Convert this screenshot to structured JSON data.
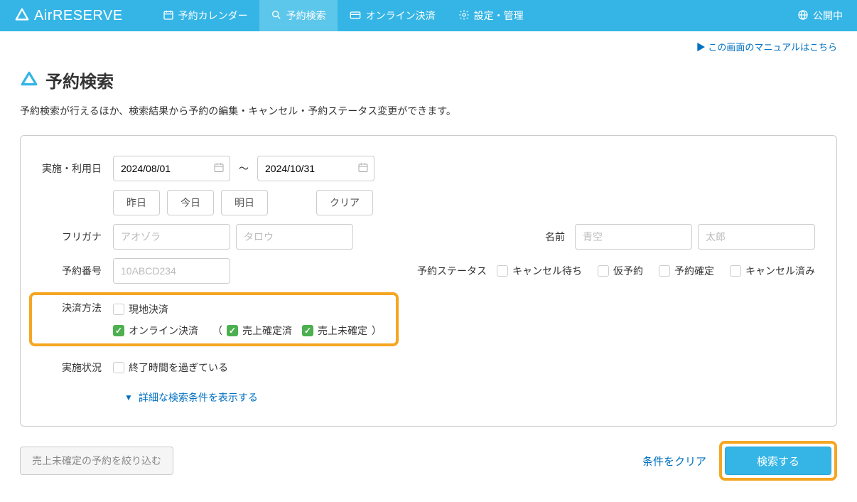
{
  "header": {
    "logo_text": "AirRESERVE",
    "nav": [
      {
        "label": "予約カレンダー"
      },
      {
        "label": "予約検索"
      },
      {
        "label": "オンライン決済"
      },
      {
        "label": "設定・管理"
      }
    ],
    "publish_status": "公開中"
  },
  "manual_link": "この画面のマニュアルはこちら",
  "page": {
    "title": "予約検索",
    "description": "予約検索が行えるほか、検索結果から予約の編集・キャンセル・予約ステータス変更ができます。"
  },
  "form": {
    "date_label": "実施・利用日",
    "date_from": "2024/08/01",
    "date_to": "2024/10/31",
    "quick": {
      "yesterday": "昨日",
      "today": "今日",
      "tomorrow": "明日",
      "clear": "クリア"
    },
    "furigana_label": "フリガナ",
    "furigana_sei_ph": "アオゾラ",
    "furigana_mei_ph": "タロウ",
    "name_label": "名前",
    "name_sei_ph": "青空",
    "name_mei_ph": "太郎",
    "resnum_label": "予約番号",
    "resnum_ph": "10ABCD234",
    "status_label": "予約ステータス",
    "status_options": [
      "キャンセル待ち",
      "仮予約",
      "予約確定",
      "キャンセル済み"
    ],
    "payment_label": "決済方法",
    "payment_onsite": "現地決済",
    "payment_online": "オンライン決済",
    "sales_confirmed": "売上確定済",
    "sales_unconfirmed": "売上未確定",
    "situation_label": "実施状況",
    "situation_option": "終了時間を過ぎている",
    "advanced_link": "詳細な検索条件を表示する"
  },
  "footer": {
    "filter_unconfirmed": "売上未確定の予約を絞り込む",
    "clear_conditions": "条件をクリア",
    "search": "検索する"
  }
}
